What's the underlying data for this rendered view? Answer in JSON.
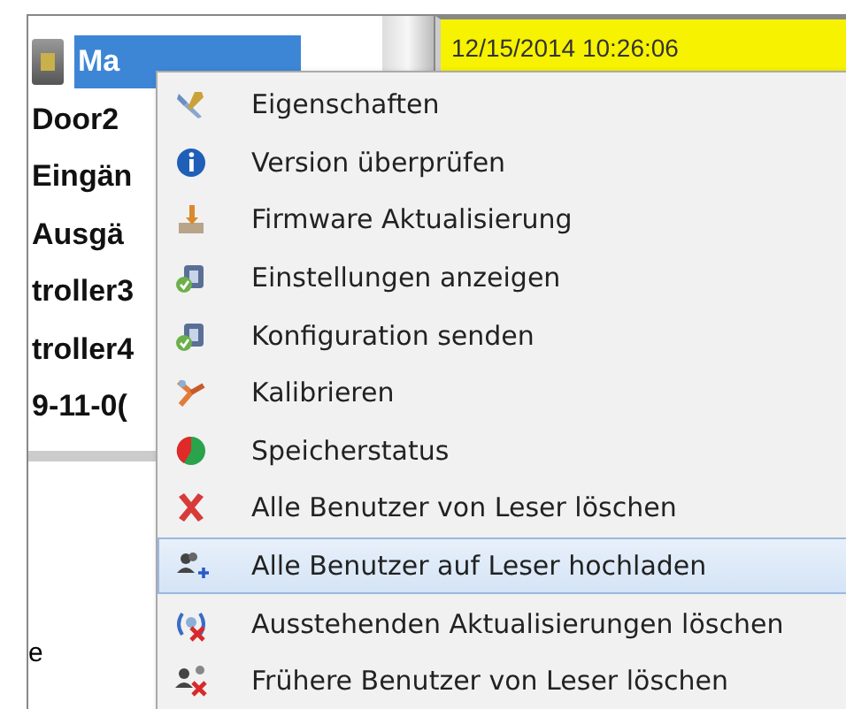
{
  "tree": {
    "items": [
      {
        "label": "Ma",
        "selected": true,
        "kind": "device"
      },
      {
        "label": "Door2",
        "selected": false,
        "kind": "text"
      },
      {
        "label": "Eingän",
        "selected": false,
        "kind": "text"
      },
      {
        "label": "Ausgä",
        "selected": false,
        "kind": "text"
      },
      {
        "label": "troller3",
        "selected": false,
        "kind": "text"
      },
      {
        "label": "troller4",
        "selected": false,
        "kind": "text"
      },
      {
        "label": "9-11-0(",
        "selected": false,
        "kind": "text"
      }
    ]
  },
  "log": {
    "time": "12/15/2014 10:26:06"
  },
  "lower_panel": {
    "fragment": "e"
  },
  "context_menu": {
    "items": [
      {
        "label": "Eigenschaften",
        "kind": "tools",
        "selected": false
      },
      {
        "label": "Version überprüfen",
        "kind": "info",
        "selected": false
      },
      {
        "label": "Firmware Aktualisierung",
        "kind": "firmware",
        "selected": false
      },
      {
        "label": "Einstellungen anzeigen",
        "kind": "settings",
        "selected": false
      },
      {
        "label": "Konfiguration senden",
        "kind": "settings",
        "selected": false
      },
      {
        "label": "Kalibrieren",
        "kind": "calibrate",
        "selected": false
      },
      {
        "label": "Speicherstatus",
        "kind": "memory",
        "selected": false
      },
      {
        "label": "Alle Benutzer von Leser löschen",
        "kind": "delete",
        "selected": false
      },
      {
        "label": "Alle Benutzer auf Leser hochladen",
        "kind": "upload",
        "selected": true
      },
      {
        "label": "Ausstehenden Aktualisierungen löschen",
        "kind": "pending",
        "selected": false
      },
      {
        "label": "Frühere Benutzer von Leser löschen",
        "kind": "former",
        "selected": false
      }
    ]
  }
}
